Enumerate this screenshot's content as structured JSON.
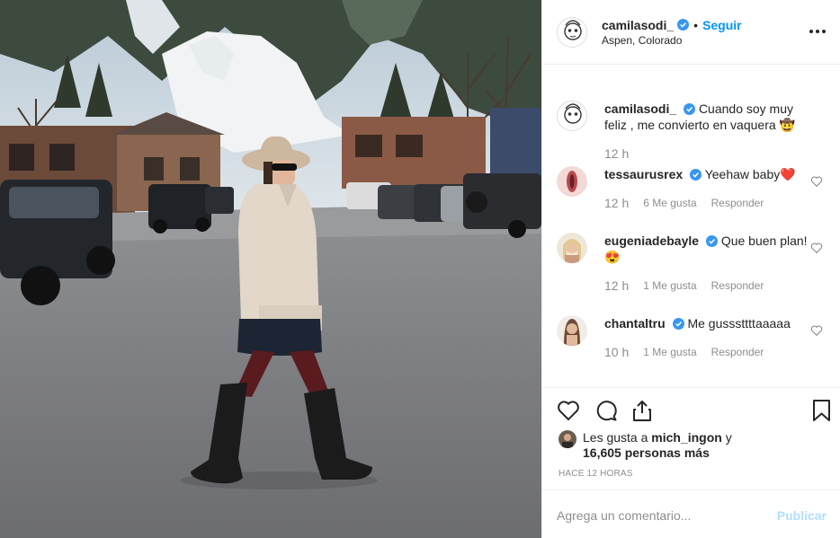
{
  "header": {
    "username": "camilasodi_",
    "separator": "•",
    "follow_label": "Seguir",
    "location": "Aspen, Colorado"
  },
  "comments": [
    {
      "username": "camilasodi_",
      "text": "Cuando soy muy feliz , me convierto en vaquera 🤠",
      "time": "12 h",
      "likes": "",
      "reply": ""
    },
    {
      "username": "tessaurusrex",
      "text": "Yeehaw baby❤️",
      "time": "12 h",
      "likes": "6 Me gusta",
      "reply": "Responder"
    },
    {
      "username": "eugeniadebayle",
      "text": "Que buen plan! 😍",
      "time": "12 h",
      "likes": "1 Me gusta",
      "reply": "Responder"
    },
    {
      "username": "chantaltru",
      "text": "Me gusssttttaaaaa",
      "time": "10 h",
      "likes": "1 Me gusta",
      "reply": "Responder"
    }
  ],
  "likes": {
    "prefix": "Les gusta a ",
    "user": "mich_ingon",
    "middle": " y",
    "count": "16,605 personas más"
  },
  "time_ago": "HACE 12 HORAS",
  "comment_box": {
    "placeholder": "Agrega un comentario...",
    "publish_label": "Publicar"
  },
  "icons": {
    "like": "heart-icon",
    "comment": "comment-icon",
    "share": "share-icon",
    "save": "bookmark-icon",
    "verified": "verified-badge-icon",
    "more": "more-options-icon"
  },
  "colors": {
    "link_blue": "#0095f6",
    "verified_blue": "#3897f0",
    "muted_text": "#8e8e8e",
    "disabled_blue": "#b2dffc"
  }
}
